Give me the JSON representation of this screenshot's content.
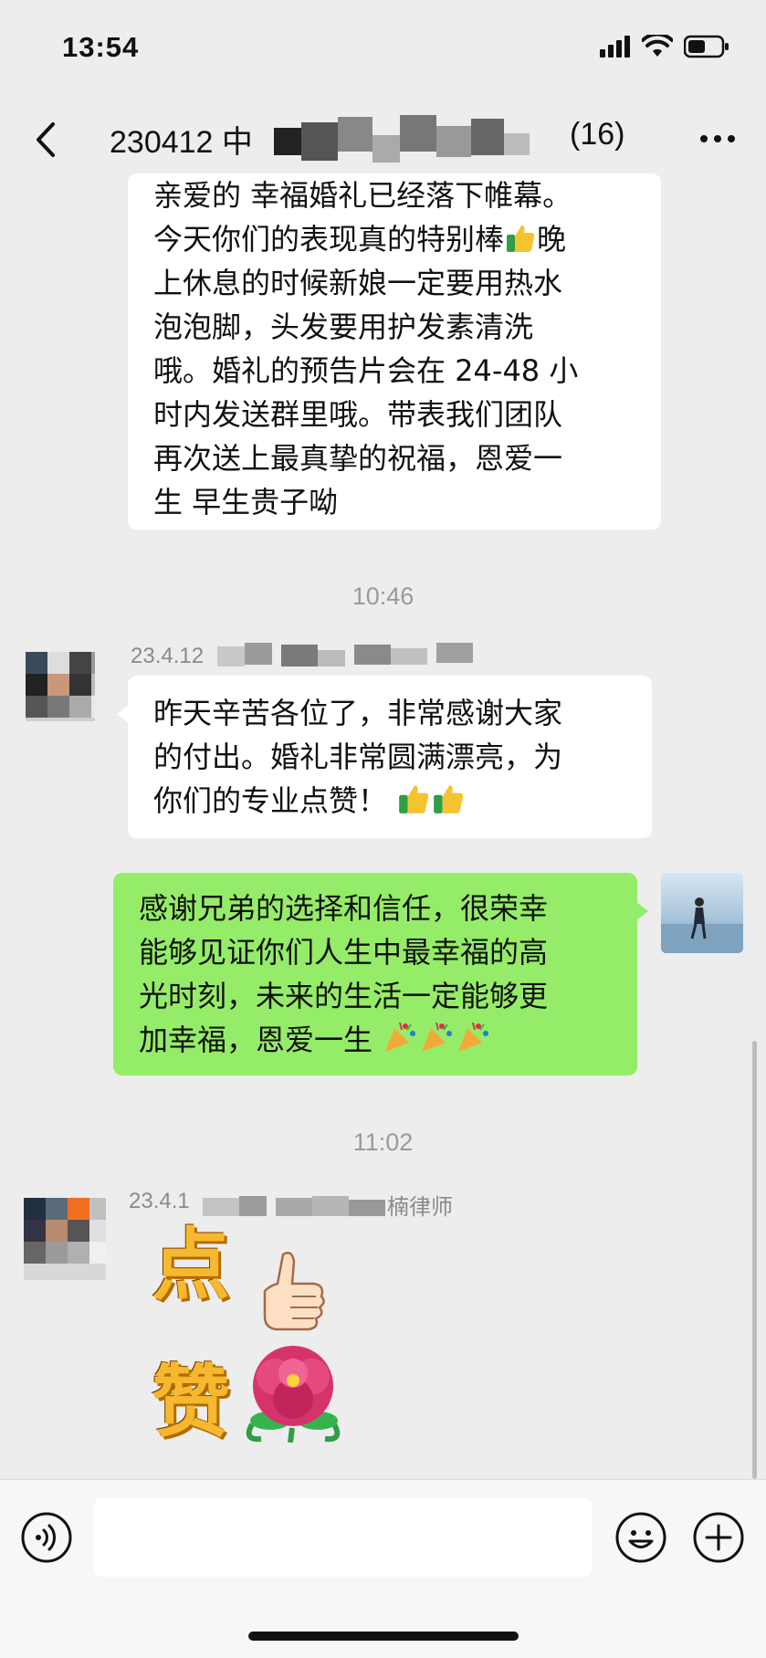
{
  "status_bar": {
    "time": "13:54",
    "icons": [
      "signal-icon",
      "wifi-icon",
      "battery-icon"
    ]
  },
  "nav": {
    "back_icon": "chevron-left-icon",
    "title": "230412 中",
    "member_count": "(16)",
    "more_icon": "more-dots-icon"
  },
  "messages": {
    "msg1": {
      "lines": [
        "亲爱的 幸福婚礼已经落下帷幕。",
        "今天你们的表现真的特别棒",
        "晚",
        "上休息的时候新娘一定要用热水",
        "泡泡脚，头发要用护发素清洗",
        "哦。婚礼的预告片会在 24-48 小",
        "时内发送群里哦。带表我们团队",
        "再次送上最真挚的祝福，恩爱一",
        "生 早生贵子呦"
      ]
    },
    "timestamp1": "10:46",
    "msg2": {
      "sender": "23.4.12",
      "lines": [
        "昨天辛苦各位了，非常感谢大家",
        "的付出。婚礼非常圆满漂亮，为",
        "你们的专业点赞！"
      ]
    },
    "msg3": {
      "lines": [
        "感谢兄弟的选择和信任，很荣幸",
        "能够见证你们人生中最幸福的高",
        "光时刻，未来的生活一定能够更",
        "加幸福，恩爱一生"
      ]
    },
    "timestamp2": "11:02",
    "msg4": {
      "sender_prefix": "23.4.1",
      "sender_suffix": "楠律师",
      "sticker_text": [
        "点",
        "赞"
      ]
    }
  },
  "bottom_bar": {
    "voice_icon": "voice-icon",
    "emoji_icon": "emoji-icon",
    "plus_icon": "plus-icon"
  },
  "colors": {
    "background": "#ededed",
    "bubble_in": "#ffffff",
    "bubble_out": "#95ec69"
  }
}
